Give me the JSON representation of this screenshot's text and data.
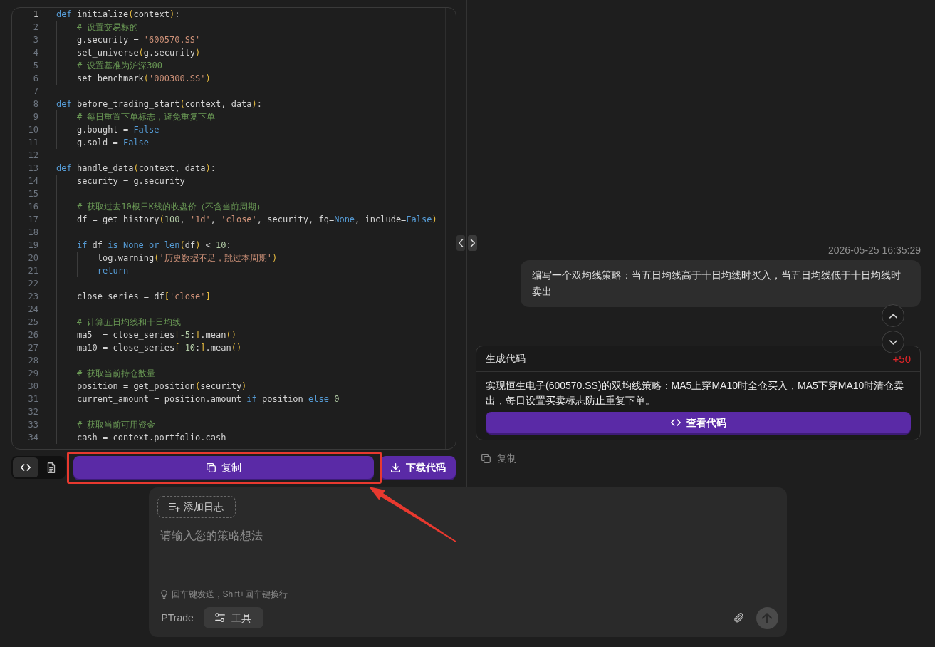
{
  "editor": {
    "lines": [
      {
        "number": "1",
        "active": true,
        "tokens": [
          {
            "kind": "keyword",
            "text": "def"
          },
          {
            "kind": "plain",
            "text": " initialize"
          },
          {
            "kind": "bracket",
            "text": "("
          },
          {
            "kind": "plain",
            "text": "context"
          },
          {
            "kind": "bracket",
            "text": ")"
          },
          {
            "kind": "plain",
            "text": ":"
          }
        ]
      },
      {
        "number": "2",
        "active": false,
        "tokens": [
          {
            "kind": "comment",
            "text": "    # 设置交易标的"
          }
        ]
      },
      {
        "number": "3",
        "active": false,
        "tokens": [
          {
            "kind": "plain",
            "text": "    g.security = "
          },
          {
            "kind": "string",
            "text": "'600570.SS'"
          }
        ]
      },
      {
        "number": "4",
        "active": false,
        "tokens": [
          {
            "kind": "plain",
            "text": "    set_universe"
          },
          {
            "kind": "bracket",
            "text": "("
          },
          {
            "kind": "plain",
            "text": "g.security"
          },
          {
            "kind": "bracket",
            "text": ")"
          }
        ]
      },
      {
        "number": "5",
        "active": false,
        "tokens": [
          {
            "kind": "comment",
            "text": "    # 设置基准为沪深300"
          }
        ]
      },
      {
        "number": "6",
        "active": false,
        "tokens": [
          {
            "kind": "plain",
            "text": "    set_benchmark"
          },
          {
            "kind": "bracket",
            "text": "("
          },
          {
            "kind": "string",
            "text": "'000300.SS'"
          },
          {
            "kind": "bracket",
            "text": ")"
          }
        ]
      },
      {
        "number": "7",
        "active": false
      },
      {
        "number": "8",
        "active": false,
        "tokens": [
          {
            "kind": "keyword",
            "text": "def"
          },
          {
            "kind": "plain",
            "text": " before_trading_start"
          },
          {
            "kind": "bracket",
            "text": "("
          },
          {
            "kind": "plain",
            "text": "context, data"
          },
          {
            "kind": "bracket",
            "text": ")"
          },
          {
            "kind": "plain",
            "text": ":"
          }
        ]
      },
      {
        "number": "9",
        "active": false,
        "tokens": [
          {
            "kind": "comment",
            "text": "    # 每日重置下单标志，避免重复下单"
          }
        ]
      },
      {
        "number": "10",
        "active": false,
        "tokens": [
          {
            "kind": "plain",
            "text": "    g.bought = "
          },
          {
            "kind": "keyword",
            "text": "False"
          }
        ]
      },
      {
        "number": "11",
        "active": false,
        "tokens": [
          {
            "kind": "plain",
            "text": "    g.sold = "
          },
          {
            "kind": "keyword",
            "text": "False"
          }
        ]
      },
      {
        "number": "12",
        "active": false
      },
      {
        "number": "13",
        "active": false,
        "tokens": [
          {
            "kind": "keyword",
            "text": "def"
          },
          {
            "kind": "plain",
            "text": " handle_data"
          },
          {
            "kind": "bracket",
            "text": "("
          },
          {
            "kind": "plain",
            "text": "context, data"
          },
          {
            "kind": "bracket",
            "text": ")"
          },
          {
            "kind": "plain",
            "text": ":"
          }
        ]
      },
      {
        "number": "14",
        "active": false,
        "tokens": [
          {
            "kind": "plain",
            "text": "    security = g.security"
          }
        ]
      },
      {
        "number": "15",
        "active": false
      },
      {
        "number": "16",
        "active": false,
        "tokens": [
          {
            "kind": "comment",
            "text": "    # 获取过去10根日K线的收盘价（不含当前周期）"
          }
        ]
      },
      {
        "number": "17",
        "active": false,
        "tokens": [
          {
            "kind": "plain",
            "text": "    df = get_history"
          },
          {
            "kind": "bracket",
            "text": "("
          },
          {
            "kind": "number",
            "text": "100"
          },
          {
            "kind": "plain",
            "text": ", "
          },
          {
            "kind": "string",
            "text": "'1d'"
          },
          {
            "kind": "plain",
            "text": ", "
          },
          {
            "kind": "string",
            "text": "'close'"
          },
          {
            "kind": "plain",
            "text": ", security, fq="
          },
          {
            "kind": "keyword",
            "text": "None"
          },
          {
            "kind": "plain",
            "text": ", include="
          },
          {
            "kind": "keyword",
            "text": "False"
          },
          {
            "kind": "bracket",
            "text": ")"
          }
        ]
      },
      {
        "number": "18",
        "active": false
      },
      {
        "number": "19",
        "active": false,
        "tokens": [
          {
            "kind": "keyword",
            "text": "    if"
          },
          {
            "kind": "plain",
            "text": " df "
          },
          {
            "kind": "keyword",
            "text": "is"
          },
          {
            "kind": "keyword",
            "text": " None"
          },
          {
            "kind": "keyword",
            "text": " or"
          },
          {
            "kind": "keyword",
            "text": " len"
          },
          {
            "kind": "bracket",
            "text": "("
          },
          {
            "kind": "plain",
            "text": "df"
          },
          {
            "kind": "bracket",
            "text": ")"
          },
          {
            "kind": "plain",
            "text": " < "
          },
          {
            "kind": "number",
            "text": "10"
          },
          {
            "kind": "plain",
            "text": ":"
          }
        ]
      },
      {
        "number": "20",
        "active": false,
        "tokens": [
          {
            "kind": "plain",
            "text": "        log.warning"
          },
          {
            "kind": "bracket",
            "text": "("
          },
          {
            "kind": "string",
            "text": "'历史数据不足，跳过本周期'"
          },
          {
            "kind": "bracket",
            "text": ")"
          }
        ]
      },
      {
        "number": "21",
        "active": false,
        "tokens": [
          {
            "kind": "keyword",
            "text": "        return"
          }
        ]
      },
      {
        "number": "22",
        "active": false
      },
      {
        "number": "23",
        "active": false,
        "tokens": [
          {
            "kind": "plain",
            "text": "    close_series = df"
          },
          {
            "kind": "bracket",
            "text": "["
          },
          {
            "kind": "string",
            "text": "'close'"
          },
          {
            "kind": "bracket",
            "text": "]"
          }
        ]
      },
      {
        "number": "24",
        "active": false
      },
      {
        "number": "25",
        "active": false,
        "tokens": [
          {
            "kind": "comment",
            "text": "    # 计算五日均线和十日均线"
          }
        ]
      },
      {
        "number": "26",
        "active": false,
        "tokens": [
          {
            "kind": "plain",
            "text": "    ma5  = close_series"
          },
          {
            "kind": "bracket",
            "text": "["
          },
          {
            "kind": "number",
            "text": "-5"
          },
          {
            "kind": "plain",
            "text": ":"
          },
          {
            "kind": "bracket",
            "text": "]"
          },
          {
            "kind": "plain",
            "text": ".mean"
          },
          {
            "kind": "bracket",
            "text": "()"
          }
        ]
      },
      {
        "number": "27",
        "active": false,
        "tokens": [
          {
            "kind": "plain",
            "text": "    ma10 = close_series"
          },
          {
            "kind": "bracket",
            "text": "["
          },
          {
            "kind": "number",
            "text": "-10"
          },
          {
            "kind": "plain",
            "text": ":"
          },
          {
            "kind": "bracket",
            "text": "]"
          },
          {
            "kind": "plain",
            "text": ".mean"
          },
          {
            "kind": "bracket",
            "text": "()"
          }
        ]
      },
      {
        "number": "28",
        "active": false
      },
      {
        "number": "29",
        "active": false,
        "tokens": [
          {
            "kind": "comment",
            "text": "    # 获取当前持仓数量"
          }
        ]
      },
      {
        "number": "30",
        "active": false,
        "tokens": [
          {
            "kind": "plain",
            "text": "    position = get_position"
          },
          {
            "kind": "bracket",
            "text": "("
          },
          {
            "kind": "plain",
            "text": "security"
          },
          {
            "kind": "bracket",
            "text": ")"
          }
        ]
      },
      {
        "number": "31",
        "active": false,
        "tokens": [
          {
            "kind": "plain",
            "text": "    current_amount = position.amount "
          },
          {
            "kind": "keyword",
            "text": "if"
          },
          {
            "kind": "plain",
            "text": " position "
          },
          {
            "kind": "keyword",
            "text": "else"
          },
          {
            "kind": "number",
            "text": " 0"
          }
        ]
      },
      {
        "number": "32",
        "active": false
      },
      {
        "number": "33",
        "active": false,
        "tokens": [
          {
            "kind": "comment",
            "text": "    # 获取当前可用资金"
          }
        ]
      },
      {
        "number": "34",
        "active": false,
        "tokens": [
          {
            "kind": "plain",
            "text": "    cash = context.portfolio.cash"
          }
        ]
      }
    ]
  },
  "editor_toolbar": {
    "view_tabs": [
      {
        "kind": "code",
        "selected": true
      },
      {
        "kind": "document",
        "selected": false
      }
    ],
    "copy_button": "复制",
    "download_button": "下载代码"
  },
  "chat": {
    "timestamp": "2026-05-25 16:35:29",
    "user_message": "编写一个双均线策略：当五日均线高于十日均线时买入，当五日均线低于十日均线时卖出",
    "result_card": {
      "title": "生成代码",
      "points": "+50",
      "summary": "实现恒生电子(600570.SS)的双均线策略：MA5上穿MA10时全仓买入，MA5下穿MA10时清仓卖出，每日设置买卖标志防止重复下单。",
      "view_code_button": "查看代码"
    },
    "copy_action": "复制"
  },
  "composer": {
    "add_log_button": "添加日志",
    "input": {
      "placeholder": "请输入您的策略想法"
    },
    "hint": "回车键发送，Shift+回车键换行",
    "mode_label": "PTrade",
    "tools_button": "工具",
    "send_button": {
      "disabled": true
    }
  }
}
